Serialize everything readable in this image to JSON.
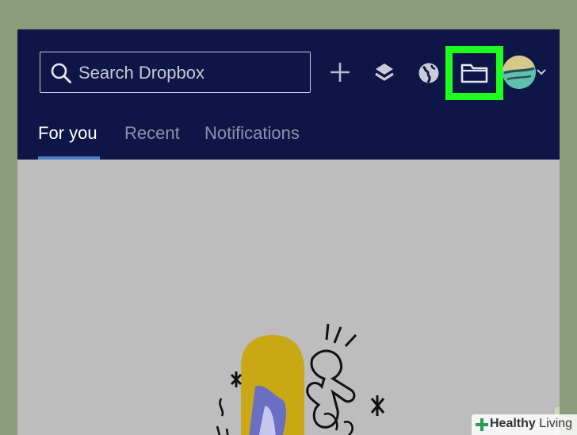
{
  "search": {
    "placeholder": "Search Dropbox"
  },
  "toolbar": {
    "icons": [
      "plus-icon",
      "layers-icon",
      "globe-icon",
      "folder-icon",
      "avatar",
      "chevron-down-icon"
    ],
    "highlight_color": "#1fff1f"
  },
  "tabs": [
    {
      "label": "For you",
      "active": true
    },
    {
      "label": "Recent",
      "active": false
    },
    {
      "label": "Notifications",
      "active": false
    }
  ],
  "colors": {
    "topbar": "#0d1647",
    "content": "#bdbdbd",
    "tab_active": "#ffffff",
    "tab_inactive": "#8d92a8",
    "tab_underline": "#4a7ec7"
  },
  "watermark": {
    "brand": "Healthy",
    "suffix": "Living"
  }
}
